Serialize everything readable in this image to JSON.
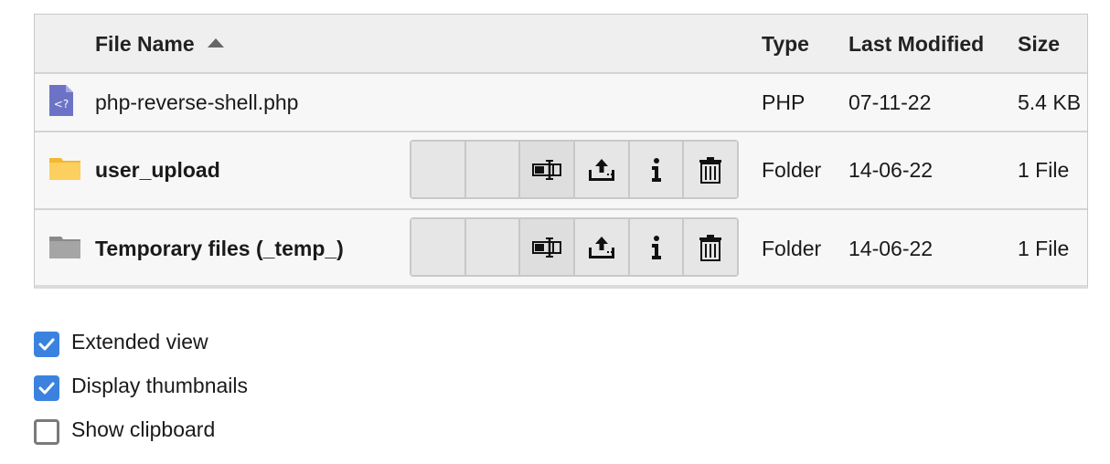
{
  "table": {
    "columns": {
      "name": "File Name",
      "type": "Type",
      "modified": "Last Modified",
      "size": "Size"
    },
    "sort": {
      "column": "name",
      "direction": "ascending"
    },
    "rows": [
      {
        "name": "php-reverse-shell.php",
        "type": "PHP",
        "modified": "07-11-22",
        "size": "5.4 KB",
        "icon": "php-file-icon",
        "icon_color": "#6c73c6"
      },
      {
        "name": "user_upload",
        "type": "Folder",
        "modified": "14-06-22",
        "size": "1 File",
        "icon": "folder-icon",
        "icon_color": "#f9c84a"
      },
      {
        "name": "Temporary files (_temp_)",
        "type": "Folder",
        "modified": "14-06-22",
        "size": "1 File",
        "icon": "folder-icon",
        "icon_color": "#9c9c9c"
      }
    ],
    "row_actions": [
      "rename-icon",
      "upload-icon",
      "info-icon",
      "delete-icon"
    ]
  },
  "options": [
    {
      "label": "Extended view",
      "checked": true
    },
    {
      "label": "Display thumbnails",
      "checked": true
    },
    {
      "label": "Show clipboard",
      "checked": false
    }
  ],
  "colors": {
    "checkbox_accent": "#3b82e0",
    "header_bg": "#efefef",
    "border": "#c8c8c8"
  }
}
